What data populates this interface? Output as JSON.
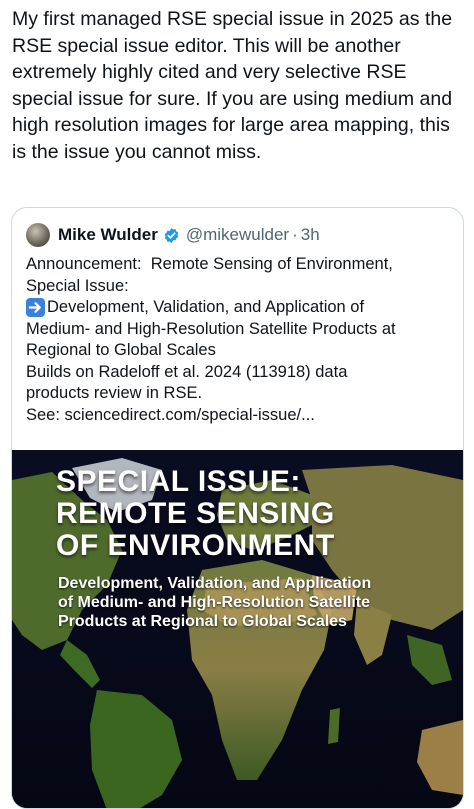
{
  "post": {
    "text": "My first managed RSE special issue in 2025 as the RSE special issue editor. This will be another extremely highly cited and very selective RSE special issue for sure. If you are using medium and high resolution images for large area mapping, this is the issue you cannot miss."
  },
  "quote": {
    "author_name": "Mike Wulder",
    "handle": "@mikewulder",
    "separator": "·",
    "time": "3h",
    "lines": [
      "Announcement:  Remote Sensing of Environment,",
      "Special Issue:",
      "Development, Validation, and Application of",
      "Medium- and High-Resolution Satellite Products at",
      "Regional to Global Scales",
      "Builds on Radeloff et al. 2024 (113918) data",
      "products review in RSE.",
      "See: sciencedirect.com/special-issue/..."
    ]
  },
  "image": {
    "title_lines": [
      "SPECIAL ISSUE:",
      "REMOTE SENSING",
      "OF ENVIRONMENT"
    ],
    "subtitle_lines": [
      "Development, Validation, and Application",
      "of Medium- and High-Resolution Satellite",
      "Products at Regional to Global Scales"
    ]
  },
  "colors": {
    "text": "#0f1419",
    "muted": "#536471",
    "verified": "#1d9bf0",
    "border": "#cfd9de",
    "arrow_emoji_bg": "#3b82d6"
  },
  "icons": {
    "verified": "verified-badge-icon",
    "arrow": "right-arrow-emoji-icon",
    "avatar": "avatar"
  }
}
